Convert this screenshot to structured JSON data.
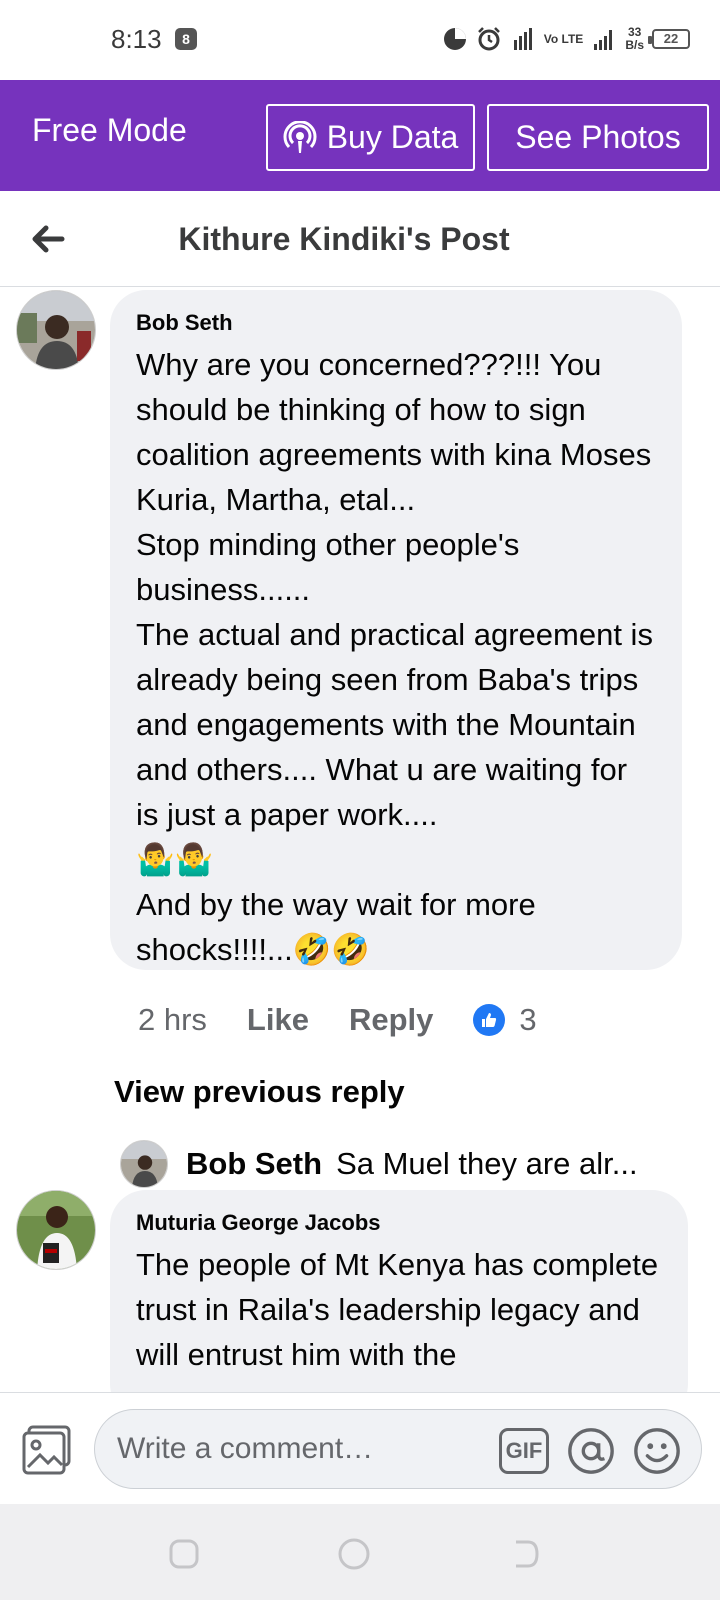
{
  "status_bar": {
    "time": "8:13",
    "app_badge": "8",
    "network_type": "4G",
    "volte": "Vo LTE",
    "net_speed_value": "33",
    "net_speed_unit": "B/s",
    "battery": "22"
  },
  "free_header": {
    "title": "Free Mode",
    "buy_data_label": "Buy Data",
    "see_photos_label": "See Photos",
    "background": "#7633bd"
  },
  "page": {
    "title": "Kithure Kindiki's Post"
  },
  "comments": [
    {
      "author": "Bob Seth",
      "text": "Why are you concerned???!!! You should be thinking of how to sign coalition agreements with kina Moses Kuria, Martha, etal...\nStop minding other people's business......\nThe actual and practical agreement is already being seen from Baba's trips and engagements with the Mountain and others.... What u are waiting for is just a paper work....\n🤷‍♂️🤷‍♂️\nAnd by the way wait for more shocks!!!!...🤣🤣",
      "time": "2 hrs",
      "like_label": "Like",
      "reply_label": "Reply",
      "reaction_count": "3"
    },
    {
      "author": "Muturia George Jacobs",
      "text": "The people of Mt Kenya has complete trust in Raila's leadership legacy and will  entrust him with the"
    }
  ],
  "replies": {
    "view_previous_label": "View previous reply",
    "preview_author": "Bob Seth",
    "preview_text": "Sa Muel they are alr..."
  },
  "composer": {
    "placeholder": "Write a comment…",
    "gif_label": "GIF"
  },
  "icons": {
    "back": "arrow-left-icon",
    "buy_data": "podcast-icon",
    "like_badge": "thumbs-up-icon",
    "photo": "photo-icon",
    "at": "at-icon",
    "smile": "smile-icon"
  },
  "colors": {
    "accent": "#7633bd",
    "bubble": "#f0f1f4",
    "like_blue": "#2078f4",
    "muted_text": "#65676b"
  }
}
